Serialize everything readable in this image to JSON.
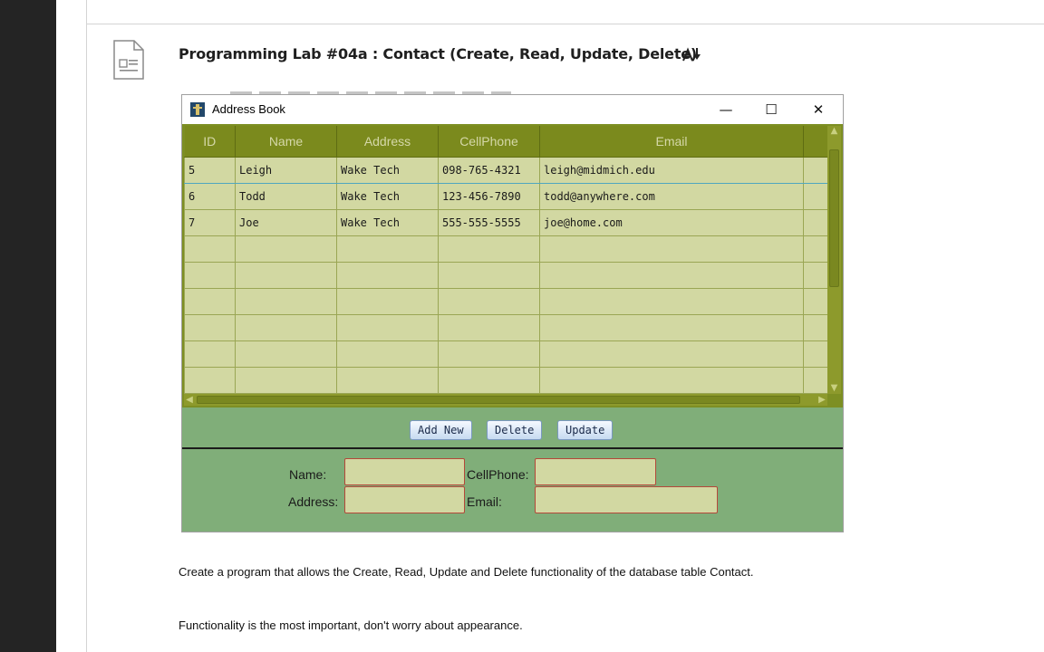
{
  "lab": {
    "title": "Programming Lab #04a : Contact (Create, Read, Update, Delete)",
    "sort_icon": "font-size-sort-icon",
    "doc_icon": "document-icon"
  },
  "window": {
    "title": "Address Book",
    "minimize": "—",
    "maximize": "☐",
    "close": "✕"
  },
  "table": {
    "columns": [
      "ID",
      "Name",
      "Address",
      "CellPhone",
      "Email"
    ],
    "rows": [
      [
        "5",
        "Leigh",
        "Wake Tech",
        "098-765-4321",
        "leigh@midmich.edu"
      ],
      [
        "6",
        "Todd",
        "Wake Tech",
        "123-456-7890",
        "todd@anywhere.com"
      ],
      [
        "7",
        "Joe",
        "Wake Tech",
        "555-555-5555",
        "joe@home.com"
      ]
    ]
  },
  "buttons": {
    "add": "Add New",
    "delete": "Delete",
    "update": "Update"
  },
  "form": {
    "name_label": "Name:",
    "address_label": "Address:",
    "cellphone_label": "CellPhone:",
    "email_label": "Email:",
    "name_value": "",
    "address_value": "",
    "cellphone_value": "",
    "email_value": ""
  },
  "body": {
    "p1": "Create a program that allows the Create, Read, Update and Delete functionality of the database table Contact.",
    "p2": "Functionality is the most important, don't worry about appearance."
  },
  "colors": {
    "header_olive": "#7b8a1d",
    "cell_fill": "#d2d8a2",
    "panel_green": "#80ae79",
    "field_border": "#b4483a"
  }
}
